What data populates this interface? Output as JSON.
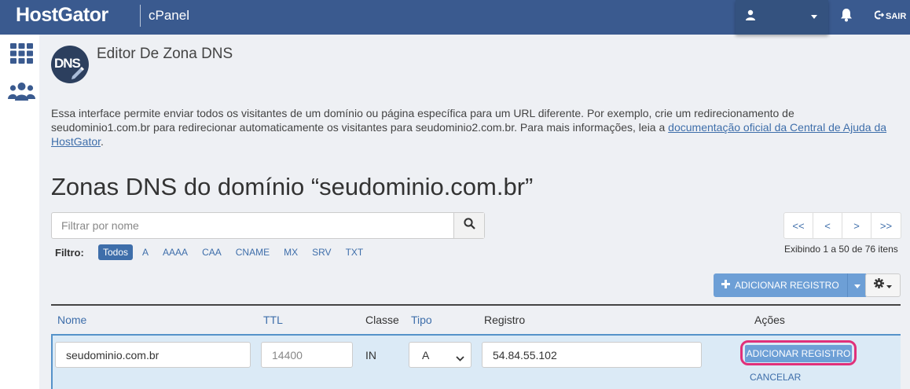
{
  "header": {
    "brand": "HostGator",
    "product": "cPanel",
    "user_icon": "user-icon",
    "bell_icon": "bell-icon",
    "logout_label": "SAIR"
  },
  "sidebar": {
    "items": [
      {
        "icon": "grid-icon"
      },
      {
        "icon": "users-icon"
      }
    ]
  },
  "page": {
    "logo_text": "DNS",
    "title": "Editor De Zona DNS",
    "intro_text": "Essa interface permite enviar todos os visitantes de um domínio ou página específica para um URL diferente. Por exemplo, crie um redirecionamento de seudominio1.com.br para redirecionar automaticamente os visitantes para seudominio2.com.br. Para mais informações, leia a ",
    "intro_link": "documentação oficial da Central de Ajuda da HostGator",
    "intro_end": ".",
    "zone_title": "Zonas DNS do domínio “seudominio.com.br”"
  },
  "search": {
    "placeholder": "Filtrar por nome"
  },
  "filters": {
    "label": "Filtro:",
    "options": [
      "Todos",
      "A",
      "AAAA",
      "CAA",
      "CNAME",
      "MX",
      "SRV",
      "TXT"
    ],
    "selected": "Todos"
  },
  "pagination": {
    "buttons": [
      "<<",
      "<",
      ">",
      ">>"
    ],
    "showing": "Exibindo 1 a 50 de 76 itens"
  },
  "toolbar": {
    "add_label": "ADICIONAR REGISTRO"
  },
  "table": {
    "headers": {
      "name": "Nome",
      "ttl": "TTL",
      "class": "Classe",
      "type": "Tipo",
      "record": "Registro",
      "actions": "Ações"
    },
    "edit_row": {
      "name": "seudominio.com.br",
      "ttl": "14400",
      "class": "IN",
      "type": "A",
      "record": "54.84.55.102",
      "add_action": "ADICIONAR REGISTRO",
      "cancel_action": "CANCELAR"
    }
  },
  "colors": {
    "topbar": "#3a5a8f",
    "accent": "#3e6eaa",
    "button": "#6d9fd6",
    "highlight": "#e0307a",
    "edit_row_bg": "#dbeaf6"
  }
}
